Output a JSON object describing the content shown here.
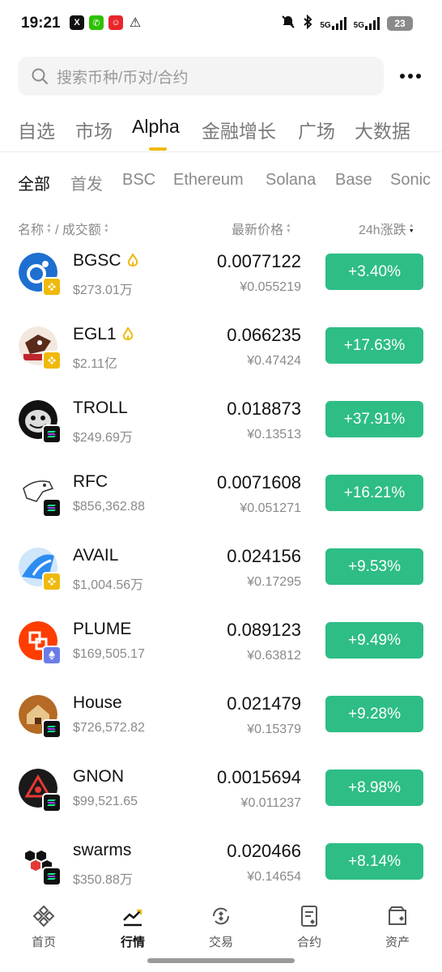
{
  "status_bar": {
    "time": "19:21",
    "battery": "23",
    "signal1": "5G",
    "signal2": "5G"
  },
  "search": {
    "placeholder": "搜索币种/币对/合约"
  },
  "main_tabs": [
    {
      "label": "自选",
      "active": false
    },
    {
      "label": "市场",
      "active": false
    },
    {
      "label": "Alpha",
      "active": true
    },
    {
      "label": "金融增长",
      "active": false
    },
    {
      "label": "广场",
      "active": false
    },
    {
      "label": "大数据",
      "active": false
    }
  ],
  "sub_tabs": [
    {
      "label": "全部",
      "active": true
    },
    {
      "label": "首发",
      "active": false
    },
    {
      "label": "BSC",
      "active": false
    },
    {
      "label": "Ethereum",
      "active": false
    },
    {
      "label": "Solana",
      "active": false
    },
    {
      "label": "Base",
      "active": false
    },
    {
      "label": "Sonic",
      "active": false
    }
  ],
  "columns": {
    "name": "名称",
    "volume": "/ 成交额",
    "price": "最新价格",
    "change": "24h涨跌"
  },
  "rows": [
    {
      "symbol": "BGSC",
      "hot": true,
      "volume": "$273.01万",
      "price": "0.0077122",
      "cny": "¥0.055219",
      "change": "+3.40%",
      "chain": "bsc"
    },
    {
      "symbol": "EGL1",
      "hot": true,
      "volume": "$2.11亿",
      "price": "0.066235",
      "cny": "¥0.47424",
      "change": "+17.63%",
      "chain": "bsc"
    },
    {
      "symbol": "TROLL",
      "hot": false,
      "volume": "$249.69万",
      "price": "0.018873",
      "cny": "¥0.13513",
      "change": "+37.91%",
      "chain": "solana"
    },
    {
      "symbol": "RFC",
      "hot": false,
      "volume": "$856,362.88",
      "price": "0.0071608",
      "cny": "¥0.051271",
      "change": "+16.21%",
      "chain": "solana"
    },
    {
      "symbol": "AVAIL",
      "hot": false,
      "volume": "$1,004.56万",
      "price": "0.024156",
      "cny": "¥0.17295",
      "change": "+9.53%",
      "chain": "bsc"
    },
    {
      "symbol": "PLUME",
      "hot": false,
      "volume": "$169,505.17",
      "price": "0.089123",
      "cny": "¥0.63812",
      "change": "+9.49%",
      "chain": "ethereum"
    },
    {
      "symbol": "House",
      "hot": false,
      "volume": "$726,572.82",
      "price": "0.021479",
      "cny": "¥0.15379",
      "change": "+9.28%",
      "chain": "solana"
    },
    {
      "symbol": "GNON",
      "hot": false,
      "volume": "$99,521.65",
      "price": "0.0015694",
      "cny": "¥0.011237",
      "change": "+8.98%",
      "chain": "solana"
    },
    {
      "symbol": "swarms",
      "hot": false,
      "volume": "$350.88万",
      "price": "0.020466",
      "cny": "¥0.14654",
      "change": "+8.14%",
      "chain": "solana"
    }
  ],
  "bottom_nav": [
    {
      "label": "首页",
      "icon": "binance-logo-icon",
      "active": false
    },
    {
      "label": "行情",
      "icon": "chart-trend-icon",
      "active": true
    },
    {
      "label": "交易",
      "icon": "exchange-icon",
      "active": false
    },
    {
      "label": "合约",
      "icon": "contract-document-icon",
      "active": false
    },
    {
      "label": "资产",
      "icon": "wallet-icon",
      "active": false
    }
  ],
  "colors": {
    "accent": "#f0b90b",
    "up": "#2ebd85",
    "muted": "#8a8a8a"
  }
}
